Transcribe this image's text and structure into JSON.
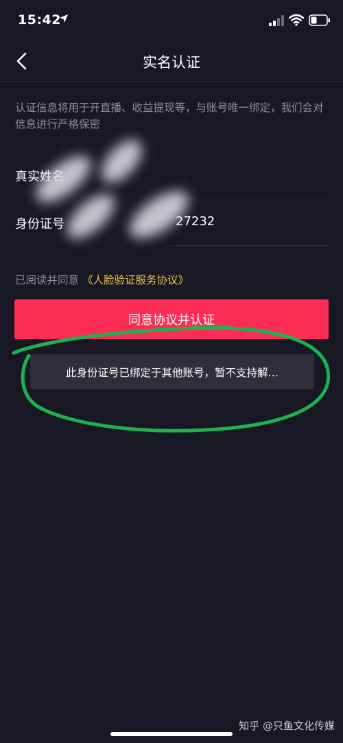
{
  "status_bar": {
    "time": "15:42"
  },
  "nav": {
    "title": "实名认证"
  },
  "notice": "认证信息将用于开直播、收益提现等，与账号唯一绑定，我们会对信息进行严格保密",
  "form": {
    "name_label": "真实姓名",
    "id_label": "身份证号",
    "id_value_visible": "27232"
  },
  "agreement": {
    "prefix": "已阅读并同意",
    "link": "《人脸验证服务协议》"
  },
  "cta_label": "同意协议并认证",
  "toast": "此身份证号已绑定于其他账号，暂不支持解…",
  "watermark": "知乎 @只鱼文化传媒",
  "colors": {
    "background": "#171824",
    "accent": "#fc2c55",
    "link": "#f4c24b",
    "annotation": "#1cb34f"
  }
}
